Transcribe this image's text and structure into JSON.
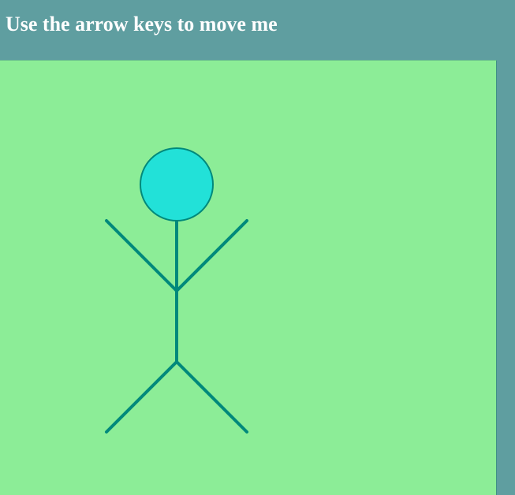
{
  "instruction_text": "Use the arrow keys to move me",
  "colors": {
    "page_background": "#5f9ea0",
    "canvas_background": "#8ced97",
    "figure_stroke": "#00897b",
    "head_fill": "#22e1d8",
    "instruction_text": "#ffffff"
  },
  "player": {
    "icon": "stick-figure-icon",
    "head": "circle",
    "controls": [
      "ArrowUp",
      "ArrowDown",
      "ArrowLeft",
      "ArrowRight"
    ]
  }
}
